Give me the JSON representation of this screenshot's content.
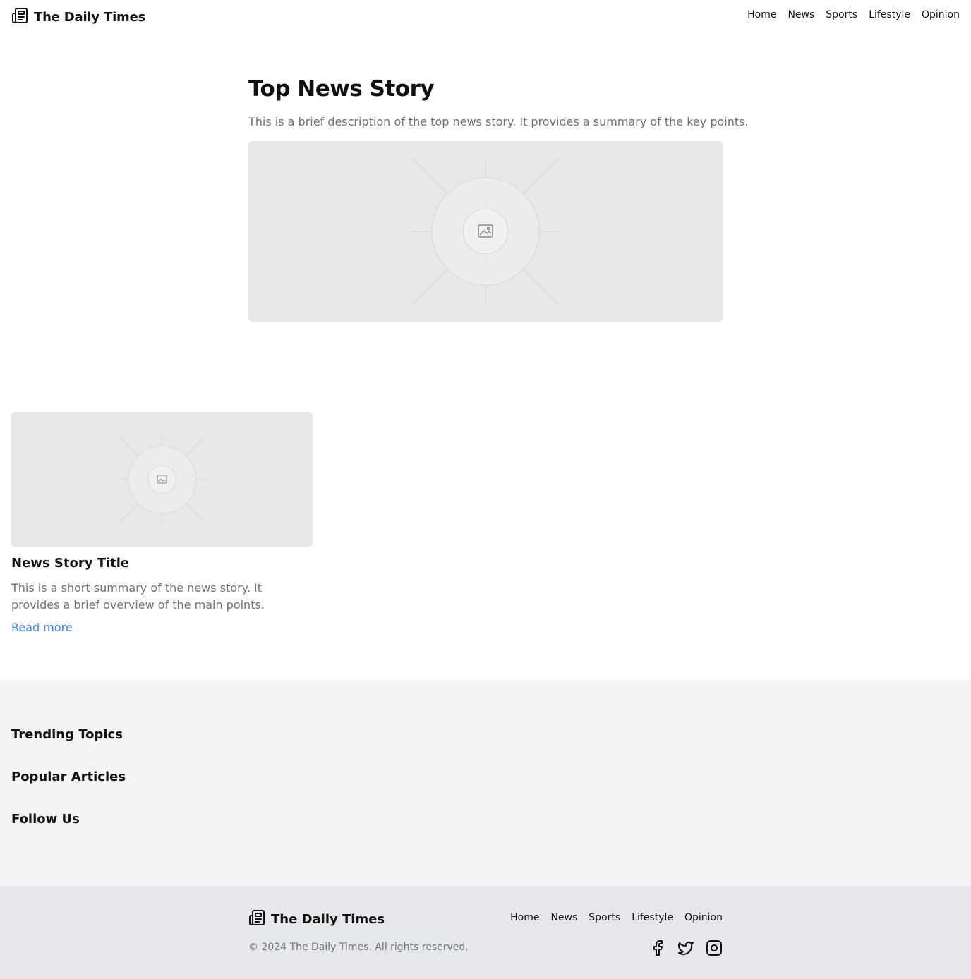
{
  "header": {
    "brand": "The Daily Times",
    "nav": [
      "Home",
      "News",
      "Sports",
      "Lifestyle",
      "Opinion"
    ]
  },
  "hero": {
    "title": "Top News Story",
    "description": "This is a brief description of the top news story. It provides a summary of the key points."
  },
  "card": {
    "title": "News Story Title",
    "summary": "This is a short summary of the news story. It provides a brief overview of the main points.",
    "link": "Read more"
  },
  "extras": {
    "trending": "Trending Topics",
    "popular": "Popular Articles",
    "follow": "Follow Us"
  },
  "footer": {
    "brand": "The Daily Times",
    "nav": [
      "Home",
      "News",
      "Sports",
      "Lifestyle",
      "Opinion"
    ],
    "copyright": "© 2024 The Daily Times. All rights reserved.",
    "social": [
      "facebook-icon",
      "twitter-icon",
      "instagram-icon"
    ]
  },
  "colors": {
    "link": "#3b82f6",
    "muted_text": "#6b7280",
    "section_bg": "#f3f4f6",
    "footer_bg": "#e5e7eb",
    "placeholder_bg": "#e8e8e8"
  }
}
